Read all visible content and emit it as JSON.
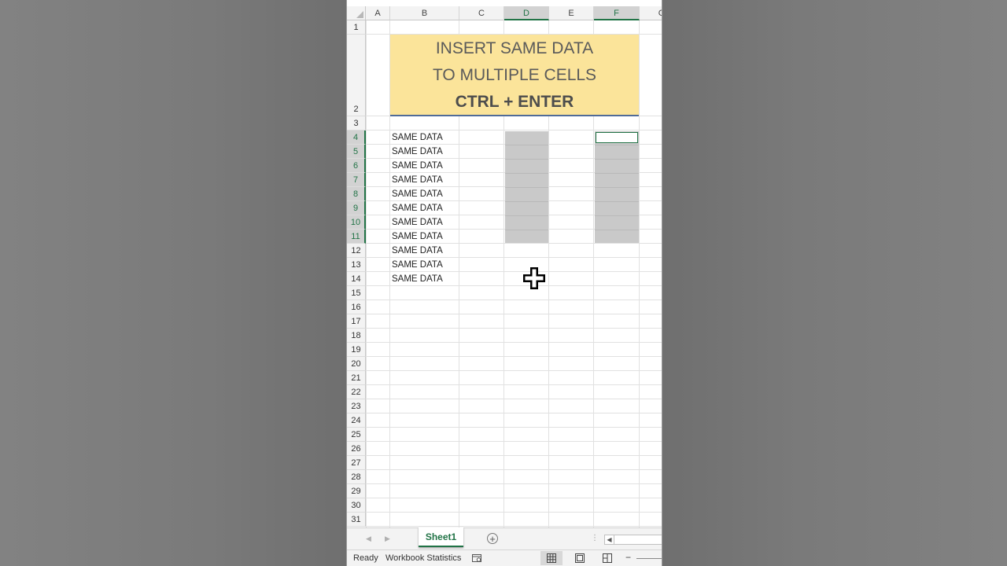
{
  "columns": [
    "A",
    "B",
    "C",
    "D",
    "E",
    "F",
    "G"
  ],
  "selected_columns": [
    "D",
    "F"
  ],
  "rows": [
    "1",
    "2",
    "3",
    "4",
    "5",
    "6",
    "7",
    "8",
    "9",
    "10",
    "11",
    "12",
    "13",
    "14",
    "15",
    "16",
    "17",
    "18",
    "19",
    "20",
    "21",
    "22",
    "23",
    "24",
    "25",
    "26",
    "27",
    "28",
    "29",
    "30",
    "31"
  ],
  "selected_rows": [
    "4",
    "5",
    "6",
    "7",
    "8",
    "9",
    "10",
    "11"
  ],
  "title_box": {
    "line1": "INSERT SAME DATA",
    "line2": "TO MULTIPLE CELLS",
    "line3": "CTRL + ENTER"
  },
  "column_b_values": [
    "SAME DATA",
    "SAME DATA",
    "SAME DATA",
    "SAME DATA",
    "SAME DATA",
    "SAME DATA",
    "SAME DATA",
    "SAME DATA",
    "SAME DATA",
    "SAME DATA",
    "SAME DATA"
  ],
  "sheet_tab": "Sheet1",
  "status": {
    "ready": "Ready",
    "workbook_statistics": "Workbook Statistics"
  },
  "icons": {
    "cursor": "cell-select-cross-icon",
    "add_sheet": "plus-circle-icon",
    "normal_view": "grid-view-icon",
    "page_layout": "page-layout-icon",
    "page_break": "page-break-icon"
  },
  "colors": {
    "title_fill": "#fbe49a",
    "title_border": "#4f6b98",
    "accent": "#217346",
    "selection_fill": "#c9c9c9"
  }
}
